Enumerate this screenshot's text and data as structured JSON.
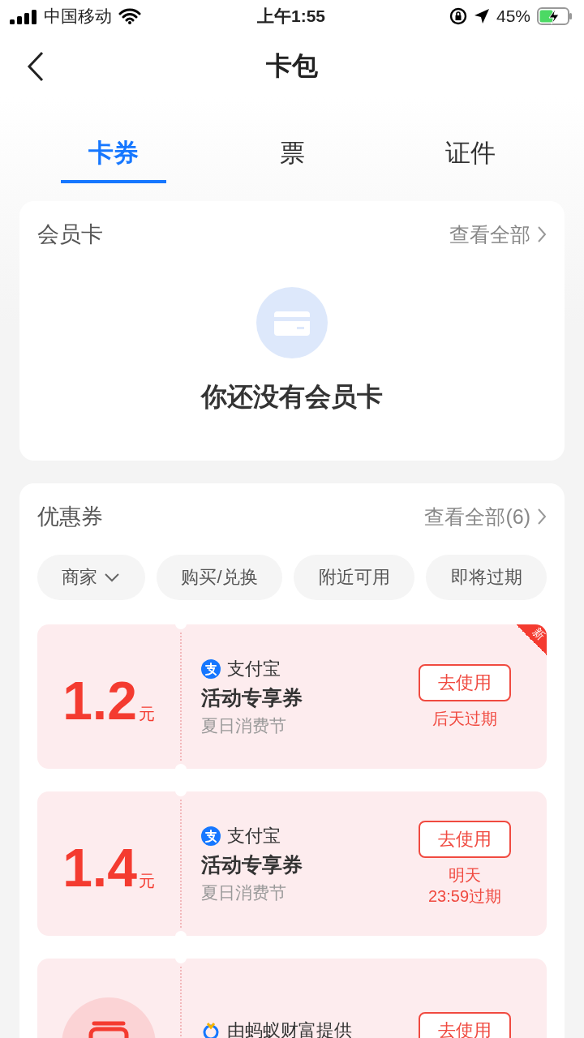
{
  "status_bar": {
    "carrier": "中国移动",
    "time": "上午1:55",
    "battery": "45%"
  },
  "nav": {
    "title": "卡包"
  },
  "tabs": [
    {
      "label": "卡券",
      "selected": true
    },
    {
      "label": "票",
      "selected": false
    },
    {
      "label": "证件",
      "selected": false
    }
  ],
  "membership": {
    "title": "会员卡",
    "view_all": "查看全部",
    "empty_text": "你还没有会员卡"
  },
  "coupons": {
    "title": "优惠券",
    "view_all": "查看全部(6)",
    "filters": [
      {
        "label": "商家",
        "has_caret": true
      },
      {
        "label": "购买/兑换",
        "has_caret": false
      },
      {
        "label": "附近可用",
        "has_caret": false
      },
      {
        "label": "即将过期",
        "has_caret": false
      }
    ],
    "items": [
      {
        "kind": "amount",
        "amount": "1.2",
        "unit": "元",
        "logo": {
          "kind": "alipay"
        },
        "provider": "支付宝",
        "title": "活动专享券",
        "subtitle": "夏日消费节",
        "button": "去使用",
        "expiry": [
          "后天过期"
        ],
        "badge": "新"
      },
      {
        "kind": "amount",
        "amount": "1.4",
        "unit": "元",
        "logo": {
          "kind": "alipay"
        },
        "provider": "支付宝",
        "title": "活动专享券",
        "subtitle": "夏日消费节",
        "button": "去使用",
        "expiry": [
          "明天",
          "23:59过期"
        ]
      },
      {
        "kind": "store",
        "logo": {
          "kind": "ring"
        },
        "provider": "由蚂蚁财富提供",
        "button": "去使用"
      }
    ]
  }
}
